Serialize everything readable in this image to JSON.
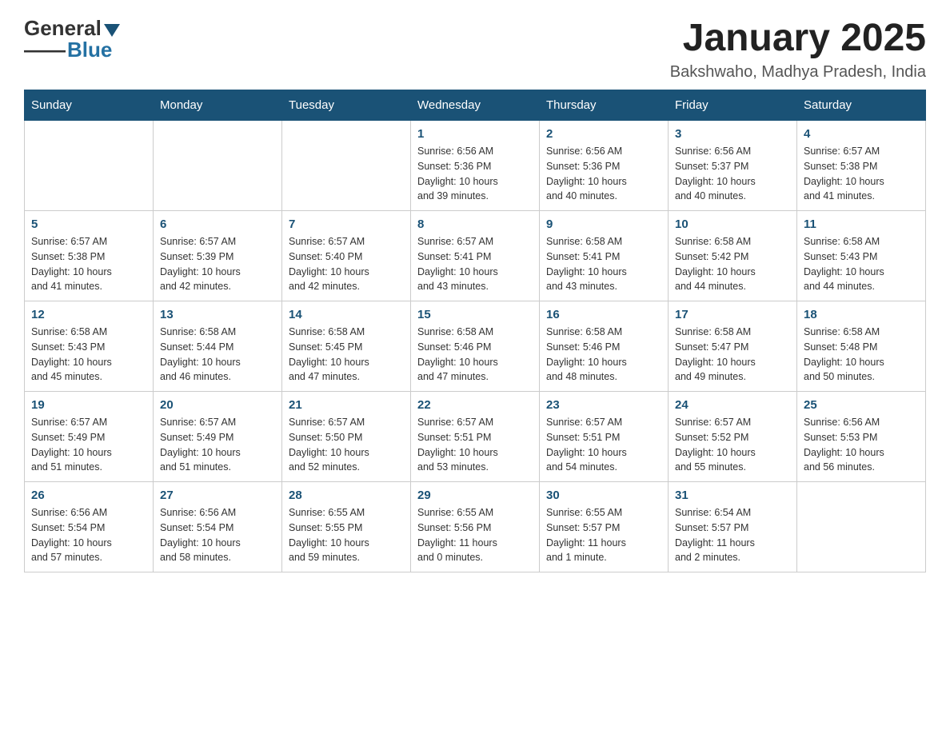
{
  "header": {
    "logo": {
      "general": "General",
      "blue": "Blue"
    },
    "title": "January 2025",
    "location": "Bakshwaho, Madhya Pradesh, India"
  },
  "weekdays": [
    "Sunday",
    "Monday",
    "Tuesday",
    "Wednesday",
    "Thursday",
    "Friday",
    "Saturday"
  ],
  "weeks": [
    [
      {
        "day": "",
        "info": ""
      },
      {
        "day": "",
        "info": ""
      },
      {
        "day": "",
        "info": ""
      },
      {
        "day": "1",
        "info": "Sunrise: 6:56 AM\nSunset: 5:36 PM\nDaylight: 10 hours\nand 39 minutes."
      },
      {
        "day": "2",
        "info": "Sunrise: 6:56 AM\nSunset: 5:36 PM\nDaylight: 10 hours\nand 40 minutes."
      },
      {
        "day": "3",
        "info": "Sunrise: 6:56 AM\nSunset: 5:37 PM\nDaylight: 10 hours\nand 40 minutes."
      },
      {
        "day": "4",
        "info": "Sunrise: 6:57 AM\nSunset: 5:38 PM\nDaylight: 10 hours\nand 41 minutes."
      }
    ],
    [
      {
        "day": "5",
        "info": "Sunrise: 6:57 AM\nSunset: 5:38 PM\nDaylight: 10 hours\nand 41 minutes."
      },
      {
        "day": "6",
        "info": "Sunrise: 6:57 AM\nSunset: 5:39 PM\nDaylight: 10 hours\nand 42 minutes."
      },
      {
        "day": "7",
        "info": "Sunrise: 6:57 AM\nSunset: 5:40 PM\nDaylight: 10 hours\nand 42 minutes."
      },
      {
        "day": "8",
        "info": "Sunrise: 6:57 AM\nSunset: 5:41 PM\nDaylight: 10 hours\nand 43 minutes."
      },
      {
        "day": "9",
        "info": "Sunrise: 6:58 AM\nSunset: 5:41 PM\nDaylight: 10 hours\nand 43 minutes."
      },
      {
        "day": "10",
        "info": "Sunrise: 6:58 AM\nSunset: 5:42 PM\nDaylight: 10 hours\nand 44 minutes."
      },
      {
        "day": "11",
        "info": "Sunrise: 6:58 AM\nSunset: 5:43 PM\nDaylight: 10 hours\nand 44 minutes."
      }
    ],
    [
      {
        "day": "12",
        "info": "Sunrise: 6:58 AM\nSunset: 5:43 PM\nDaylight: 10 hours\nand 45 minutes."
      },
      {
        "day": "13",
        "info": "Sunrise: 6:58 AM\nSunset: 5:44 PM\nDaylight: 10 hours\nand 46 minutes."
      },
      {
        "day": "14",
        "info": "Sunrise: 6:58 AM\nSunset: 5:45 PM\nDaylight: 10 hours\nand 47 minutes."
      },
      {
        "day": "15",
        "info": "Sunrise: 6:58 AM\nSunset: 5:46 PM\nDaylight: 10 hours\nand 47 minutes."
      },
      {
        "day": "16",
        "info": "Sunrise: 6:58 AM\nSunset: 5:46 PM\nDaylight: 10 hours\nand 48 minutes."
      },
      {
        "day": "17",
        "info": "Sunrise: 6:58 AM\nSunset: 5:47 PM\nDaylight: 10 hours\nand 49 minutes."
      },
      {
        "day": "18",
        "info": "Sunrise: 6:58 AM\nSunset: 5:48 PM\nDaylight: 10 hours\nand 50 minutes."
      }
    ],
    [
      {
        "day": "19",
        "info": "Sunrise: 6:57 AM\nSunset: 5:49 PM\nDaylight: 10 hours\nand 51 minutes."
      },
      {
        "day": "20",
        "info": "Sunrise: 6:57 AM\nSunset: 5:49 PM\nDaylight: 10 hours\nand 51 minutes."
      },
      {
        "day": "21",
        "info": "Sunrise: 6:57 AM\nSunset: 5:50 PM\nDaylight: 10 hours\nand 52 minutes."
      },
      {
        "day": "22",
        "info": "Sunrise: 6:57 AM\nSunset: 5:51 PM\nDaylight: 10 hours\nand 53 minutes."
      },
      {
        "day": "23",
        "info": "Sunrise: 6:57 AM\nSunset: 5:51 PM\nDaylight: 10 hours\nand 54 minutes."
      },
      {
        "day": "24",
        "info": "Sunrise: 6:57 AM\nSunset: 5:52 PM\nDaylight: 10 hours\nand 55 minutes."
      },
      {
        "day": "25",
        "info": "Sunrise: 6:56 AM\nSunset: 5:53 PM\nDaylight: 10 hours\nand 56 minutes."
      }
    ],
    [
      {
        "day": "26",
        "info": "Sunrise: 6:56 AM\nSunset: 5:54 PM\nDaylight: 10 hours\nand 57 minutes."
      },
      {
        "day": "27",
        "info": "Sunrise: 6:56 AM\nSunset: 5:54 PM\nDaylight: 10 hours\nand 58 minutes."
      },
      {
        "day": "28",
        "info": "Sunrise: 6:55 AM\nSunset: 5:55 PM\nDaylight: 10 hours\nand 59 minutes."
      },
      {
        "day": "29",
        "info": "Sunrise: 6:55 AM\nSunset: 5:56 PM\nDaylight: 11 hours\nand 0 minutes."
      },
      {
        "day": "30",
        "info": "Sunrise: 6:55 AM\nSunset: 5:57 PM\nDaylight: 11 hours\nand 1 minute."
      },
      {
        "day": "31",
        "info": "Sunrise: 6:54 AM\nSunset: 5:57 PM\nDaylight: 11 hours\nand 2 minutes."
      },
      {
        "day": "",
        "info": ""
      }
    ]
  ]
}
